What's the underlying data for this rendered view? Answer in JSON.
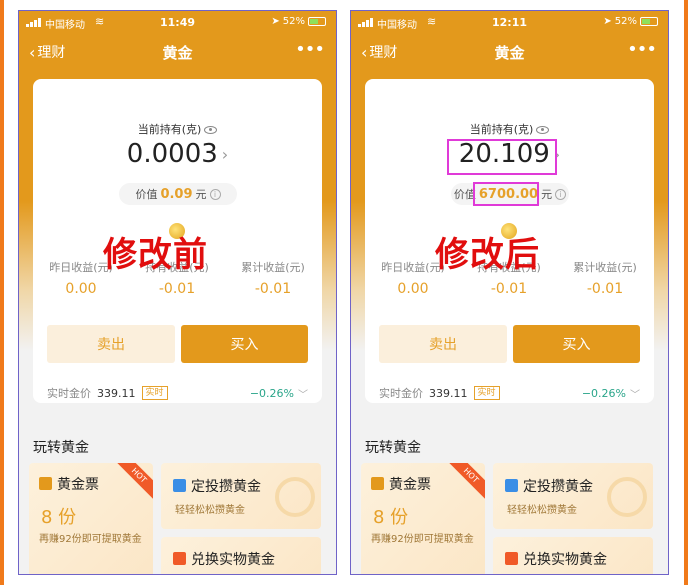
{
  "screens": [
    {
      "status": {
        "carrier": "中国移动",
        "time": "11:49",
        "battery": "52%"
      },
      "nav": {
        "back_label": "理财",
        "title": "黄金",
        "more": "•••"
      },
      "holding": {
        "label": "当前持有(克)",
        "amount": "0.0003",
        "value_prefix": "价值",
        "value": "0.09",
        "value_unit": "元"
      },
      "overlay_label": "修改前",
      "stats": [
        {
          "label": "昨日收益(元)",
          "value": "0.00"
        },
        {
          "label": "持有收益(元)",
          "value": "-0.01"
        },
        {
          "label": "累计收益(元)",
          "value": "-0.01"
        }
      ],
      "buttons": {
        "sell": "卖出",
        "buy": "买入"
      },
      "price": {
        "label": "实时金价",
        "value": "339.11",
        "tag": "实时",
        "change": "−0.26%"
      },
      "section_title": "玩转黄金",
      "tiles": {
        "ticket": {
          "name": "黄金票",
          "count": "8 份",
          "desc": "再赚92份即可提取黄金",
          "badge": "HOT"
        },
        "invest": {
          "name": "定投攒黄金",
          "desc": "轻轻松松攒黄金"
        },
        "exchange": {
          "name": "兑换实物黄金"
        }
      }
    },
    {
      "status": {
        "carrier": "中国移动",
        "time": "12:11",
        "battery": "52%"
      },
      "nav": {
        "back_label": "理财",
        "title": "黄金",
        "more": "•••"
      },
      "holding": {
        "label": "当前持有(克)",
        "amount": "20.109",
        "value_prefix": "价值",
        "value": "6700.00",
        "value_unit": "元"
      },
      "overlay_label": "修改后",
      "stats": [
        {
          "label": "昨日收益(元)",
          "value": "0.00"
        },
        {
          "label": "持有收益(元)",
          "value": "-0.01"
        },
        {
          "label": "累计收益(元)",
          "value": "-0.01"
        }
      ],
      "buttons": {
        "sell": "卖出",
        "buy": "买入"
      },
      "price": {
        "label": "实时金价",
        "value": "339.11",
        "tag": "实时",
        "change": "−0.26%"
      },
      "section_title": "玩转黄金",
      "tiles": {
        "ticket": {
          "name": "黄金票",
          "count": "8 份",
          "desc": "再赚92份即可提取黄金",
          "badge": "HOT"
        },
        "invest": {
          "name": "定投攒黄金",
          "desc": "轻轻松松攒黄金"
        },
        "exchange": {
          "name": "兑换实物黄金"
        }
      }
    }
  ],
  "colors": {
    "brand_gold": "#e3991c",
    "value_gold": "#e6a12a",
    "overlay_red": "#e10e0e",
    "highlight_magenta": "#e03ad8",
    "change_green": "#2aa58a",
    "frame_orange": "#f07a1a",
    "phone_border": "#6f63c8"
  }
}
